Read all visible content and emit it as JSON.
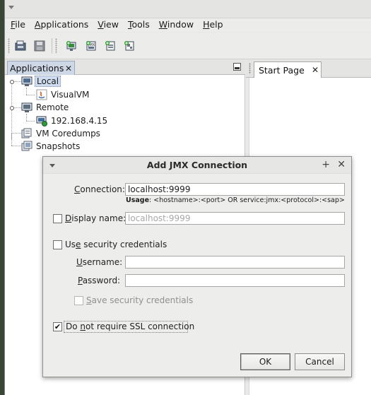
{
  "menubar": {
    "items": [
      {
        "label": "File",
        "underline": "F"
      },
      {
        "label": "Applications",
        "underline": "A"
      },
      {
        "label": "View",
        "underline": "V"
      },
      {
        "label": "Tools",
        "underline": "T"
      },
      {
        "label": "Window",
        "underline": "W"
      },
      {
        "label": "Help",
        "underline": "H"
      }
    ]
  },
  "toolbar": {
    "buttons": [
      "load-snapshot-icon",
      "save-snapshot-icon",
      "add-jmx-connection-icon",
      "add-heap-dump-icon",
      "add-thread-dump-icon",
      "add-application-icon"
    ]
  },
  "applications_panel": {
    "tab_label": "Applications",
    "tree": {
      "local": "Local",
      "visualvm": "VisualVM",
      "remote": "Remote",
      "remote_host": "192.168.4.15",
      "coredumps": "VM Coredumps",
      "snapshots": "Snapshots"
    }
  },
  "editor": {
    "start_tab_label": "Start Page"
  },
  "dialog": {
    "title": "Add JMX Connection",
    "connection_label": "Connection:",
    "connection_value": "localhost:9999",
    "usage_bold": "Usage",
    "usage_text": ": <hostname>:<port> OR service:jmx:<protocol>:<sap>",
    "display_name_label": "Display name:",
    "display_name_placeholder": "localhost:9999",
    "display_name_checked": false,
    "use_security_label": "Use security credentials",
    "use_security_checked": false,
    "username_label": "Username:",
    "username_value": "",
    "password_label": "Password:",
    "password_value": "",
    "save_credentials_label": "Save security credentials",
    "save_credentials_checked": false,
    "no_ssl_label": "Do not require SSL connection",
    "no_ssl_checked": true,
    "check_mark": "✔",
    "ok_label": "OK",
    "cancel_label": "Cancel",
    "maximize_glyph": "+",
    "close_glyph": "✕"
  },
  "colors": {
    "selection": "#cfdcef",
    "desktop": "#3f4a3a"
  }
}
